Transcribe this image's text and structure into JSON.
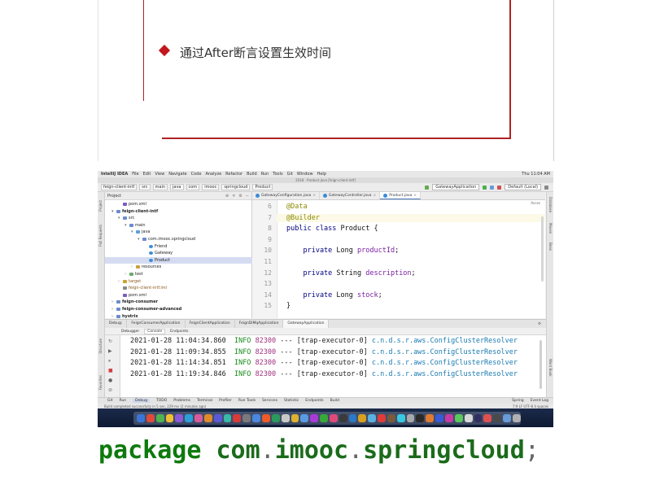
{
  "slide": {
    "bullet_text": "通过After断言设置生效时间",
    "accent_color": "#b22222"
  },
  "ide": {
    "menubar": {
      "items": [
        "IntelliJ IDEA",
        "File",
        "Edit",
        "View",
        "Navigate",
        "Code",
        "Analyze",
        "Refactor",
        "Build",
        "Run",
        "Tools",
        "Git",
        "Window",
        "Help"
      ],
      "clock": "Thu 11:04 AM"
    },
    "window_title": "2018 · Product.java [feign-client-intf]",
    "breadcrumbs": [
      "feign-client-intf",
      "src",
      "main",
      "java",
      "com",
      "imooc",
      "springcloud",
      "Product"
    ],
    "run_config": "GatewayApplication",
    "branch": "Default (Local)",
    "project_panel": {
      "title": "Project",
      "rows": [
        {
          "label": "pom.xml",
          "indent": 2,
          "icon": "file-icon",
          "color": "#7a5cc2"
        },
        {
          "label": "feign-client-intf",
          "indent": 1,
          "icon": "folder-icon",
          "color": "#6b8ccc",
          "bold": true,
          "expanded": true
        },
        {
          "label": "src",
          "indent": 2,
          "icon": "folder-icon",
          "color": "#6b8ccc",
          "expanded": true
        },
        {
          "label": "main",
          "indent": 3,
          "icon": "folder-icon",
          "color": "#6b8ccc",
          "expanded": true
        },
        {
          "label": "java",
          "indent": 4,
          "icon": "folder-icon",
          "color": "#5aa0d8",
          "expanded": true
        },
        {
          "label": "com.imooc.springcloud",
          "indent": 5,
          "icon": "package-icon",
          "color": "#6b8ccc",
          "expanded": true
        },
        {
          "label": "Friend",
          "indent": 6,
          "icon": "class-icon",
          "color": "#3b8cd6"
        },
        {
          "label": "Gateway",
          "indent": 6,
          "icon": "class-icon",
          "color": "#3b8cd6"
        },
        {
          "label": "Product",
          "indent": 6,
          "icon": "class-icon",
          "color": "#3b8cd6",
          "selected": true
        },
        {
          "label": "resources",
          "indent": 4,
          "icon": "folder-icon",
          "color": "#c8a040"
        },
        {
          "label": "test",
          "indent": 3,
          "icon": "folder-icon",
          "color": "#6bab6b"
        },
        {
          "label": "target",
          "indent": 2,
          "icon": "folder-icon",
          "color": "#d0a030",
          "brown": true
        },
        {
          "label": "feign-client-intf.iml",
          "indent": 2,
          "icon": "file-icon",
          "color": "#888888",
          "brown": true
        },
        {
          "label": "pom.xml",
          "indent": 2,
          "icon": "file-icon",
          "color": "#7a5cc2"
        },
        {
          "label": "feign-consumer",
          "indent": 1,
          "icon": "folder-icon",
          "color": "#6b8ccc",
          "bold": true
        },
        {
          "label": "feign-consumer-advanced",
          "indent": 1,
          "icon": "folder-icon",
          "color": "#6b8ccc",
          "bold": true
        },
        {
          "label": "hystrix",
          "indent": 1,
          "icon": "folder-icon",
          "color": "#6b8ccc",
          "bold": true
        }
      ]
    },
    "editor_tabs": [
      {
        "label": "GatewayConfiguration.java",
        "active": false
      },
      {
        "label": "GatewayController.java",
        "active": false
      },
      {
        "label": "Product.java",
        "active": true
      }
    ],
    "editor_hint": "Acces",
    "code_lines": [
      {
        "no": "6",
        "tokens": [
          {
            "t": "@Data",
            "c": "ann"
          }
        ],
        "highlight": false
      },
      {
        "no": "7",
        "tokens": [
          {
            "t": "@Builder",
            "c": "ann"
          }
        ],
        "highlight": true
      },
      {
        "no": "8",
        "tokens": [
          {
            "t": "public class ",
            "c": "kw"
          },
          {
            "t": "Product {",
            "c": ""
          }
        ],
        "highlight": false
      },
      {
        "no": "9",
        "tokens": [],
        "highlight": false
      },
      {
        "no": "10",
        "tokens": [
          {
            "t": "    private ",
            "c": "kw"
          },
          {
            "t": "Long ",
            "c": ""
          },
          {
            "t": "productId",
            "c": "field"
          },
          {
            "t": ";",
            "c": ""
          }
        ],
        "highlight": false
      },
      {
        "no": "11",
        "tokens": [],
        "highlight": false
      },
      {
        "no": "12",
        "tokens": [
          {
            "t": "    private ",
            "c": "kw"
          },
          {
            "t": "String ",
            "c": ""
          },
          {
            "t": "description",
            "c": "field"
          },
          {
            "t": ";",
            "c": ""
          }
        ],
        "highlight": false
      },
      {
        "no": "13",
        "tokens": [],
        "highlight": false
      },
      {
        "no": "14",
        "tokens": [
          {
            "t": "    private ",
            "c": "kw"
          },
          {
            "t": "Long ",
            "c": ""
          },
          {
            "t": "stock",
            "c": "field"
          },
          {
            "t": ";",
            "c": ""
          }
        ],
        "highlight": false
      },
      {
        "no": "15",
        "tokens": [
          {
            "t": "}",
            "c": ""
          }
        ],
        "highlight": false
      }
    ],
    "run_tabs": [
      "Debug:",
      "FeignConsumerApplication",
      "FeignClientApplication",
      "FeignDiMqApplication",
      "GatewayApplication"
    ],
    "run_tabs_active": 4,
    "sub_tabs": [
      "Debugger",
      "Console",
      "Endpoints"
    ],
    "sub_tabs_active": 1,
    "log_lines": [
      {
        "ts": "2021-01-28 11:04:34.860",
        "lvl": "INFO",
        "pid": "82300",
        "sep": "---",
        "thread": "[trap-executor-0]",
        "cls": "c.n.d.s.r.aws.ConfigClusterResolver"
      },
      {
        "ts": "2021-01-28 11:09:34.855",
        "lvl": "INFO",
        "pid": "82300",
        "sep": "---",
        "thread": "[trap-executor-0]",
        "cls": "c.n.d.s.r.aws.ConfigClusterResolver"
      },
      {
        "ts": "2021-01-28 11:14:34.851",
        "lvl": "INFO",
        "pid": "82300",
        "sep": "---",
        "thread": "[trap-executor-0]",
        "cls": "c.n.d.s.r.aws.ConfigClusterResolver"
      },
      {
        "ts": "2021-01-28 11:19:34.846",
        "lvl": "INFO",
        "pid": "82300",
        "sep": "---",
        "thread": "[trap-executor-0]",
        "cls": "c.n.d.s.r.aws.ConfigClusterResolver"
      }
    ],
    "bottom_tabs": [
      "Git",
      "Run",
      "Debug",
      "TODO",
      "Problems",
      "Terminal",
      "Profiler",
      "Run Tools",
      "Services",
      "Statistic",
      "Endpoints",
      "Build"
    ],
    "bottom_tabs_active": 2,
    "bottom_right_tabs": [
      "Spring",
      "Event Log"
    ],
    "status_text": "Build completed successfully in 5 sec, 229 ms (2 minutes ago)",
    "status_right": "7:9  LF  UTF-8  4 spaces",
    "dock_colors": [
      "#3a76d8",
      "#e04a3a",
      "#4fb34f",
      "#f0c030",
      "#8a5ad8",
      "#2aa0d8",
      "#d85a9a",
      "#e08a2a",
      "#5a5ad8",
      "#38b8a8",
      "#d83a3a",
      "#7a7a7a",
      "#4a88e0",
      "#f05a28",
      "#2a9a5a",
      "#c8c8c8",
      "#e0b030",
      "#5a9ae0",
      "#a83ad8",
      "#38a838",
      "#e04a7a",
      "#3a3a3a",
      "#2a78c8",
      "#d8a020",
      "#5ab0e0",
      "#e03a3a",
      "#7a5a3a",
      "#38c8e0",
      "#a8a8a8",
      "#2a2a2a",
      "#e07a30",
      "#3a5ad8",
      "#c83aa8",
      "#5ac85a",
      "#d8d8d8",
      "#303060",
      "#e05050",
      "#4a4a4a",
      "#6a9ad8",
      "#b0b0b0"
    ]
  },
  "code_footer": {
    "keyword": "package",
    "parts": [
      "com",
      "imooc",
      "springcloud"
    ],
    "terminator": ";"
  }
}
